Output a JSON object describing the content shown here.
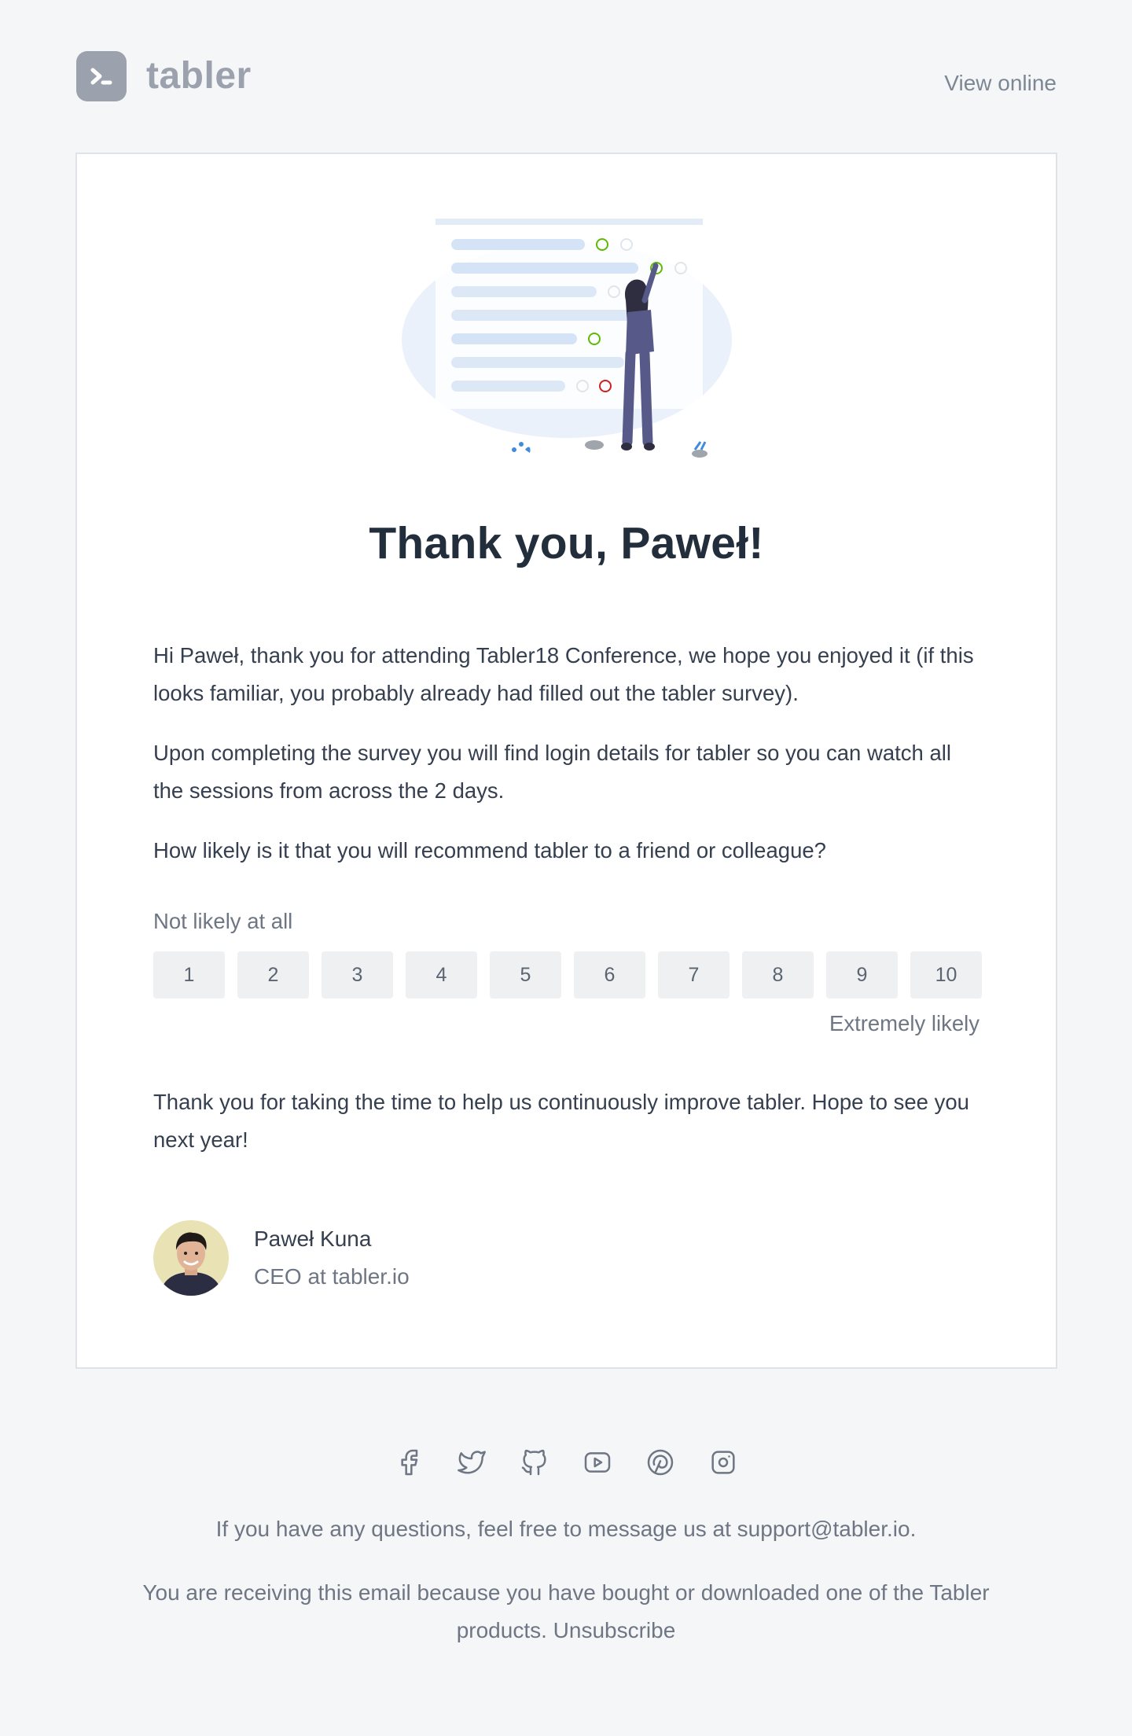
{
  "header": {
    "logo_text": "tabler",
    "view_online": "View online"
  },
  "card": {
    "title": "Thank you, Paweł!",
    "paragraphs": [
      "Hi Paweł, thank you for attending Tabler18 Conference, we hope you enjoyed it (if this looks familiar, you probably already had filled out the tabler survey).",
      "Upon completing the survey you will find login details for tabler so you can watch all the sessions from across the 2 days.",
      "How likely is it that you will recommend tabler to a friend or colleague?"
    ],
    "nps": {
      "low_label": "Not likely at all",
      "high_label": "Extremely likely",
      "options": [
        "1",
        "2",
        "3",
        "4",
        "5",
        "6",
        "7",
        "8",
        "9",
        "10"
      ]
    },
    "closing": "Thank you for taking the time to help us continuously improve tabler. Hope to see you next year!",
    "signature": {
      "name": "Paweł Kuna",
      "role": "CEO at tabler.io"
    }
  },
  "footer": {
    "social_icons": [
      "facebook-icon",
      "twitter-icon",
      "github-icon",
      "youtube-icon",
      "pinterest-icon",
      "instagram-icon"
    ],
    "questions_text": "If you have any questions, feel free to message us at support@tabler.io.",
    "receiving_text": "You are receiving this email because you have bought or downloaded one of the Tabler products.",
    "unsubscribe": "Unsubscribe"
  },
  "colors": {
    "background": "#f5f6f8",
    "card": "#ffffff",
    "heading": "#232e3c",
    "muted": "#6e7684",
    "check_green": "#5eba00",
    "cross_red": "#cd201f"
  }
}
